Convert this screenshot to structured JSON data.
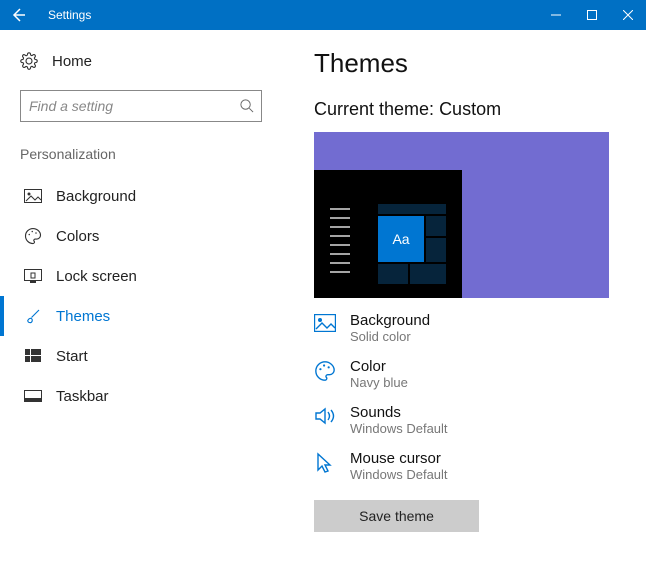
{
  "titlebar": {
    "title": "Settings"
  },
  "sidebar": {
    "home": "Home",
    "search_placeholder": "Find a setting",
    "section": "Personalization",
    "items": [
      {
        "label": "Background"
      },
      {
        "label": "Colors"
      },
      {
        "label": "Lock screen"
      },
      {
        "label": "Themes"
      },
      {
        "label": "Start"
      },
      {
        "label": "Taskbar"
      }
    ]
  },
  "main": {
    "title": "Themes",
    "current_theme_prefix": "Current theme: ",
    "current_theme_name": "Custom",
    "preview_sample": "Aa",
    "settings": [
      {
        "label": "Background",
        "value": "Solid color"
      },
      {
        "label": "Color",
        "value": "Navy blue"
      },
      {
        "label": "Sounds",
        "value": "Windows Default"
      },
      {
        "label": "Mouse cursor",
        "value": "Windows Default"
      }
    ],
    "save_label": "Save theme"
  }
}
